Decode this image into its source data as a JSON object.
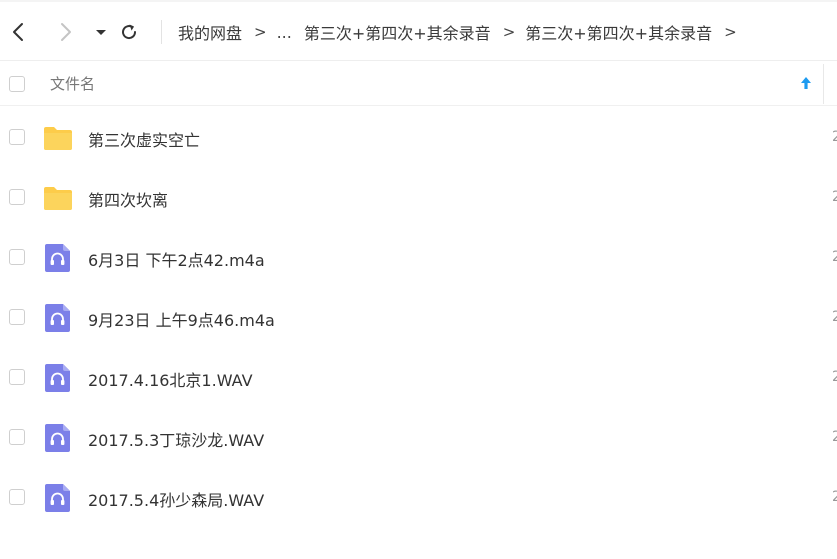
{
  "toolbar": {
    "back_icon": "chevron-left-icon",
    "forward_icon": "chevron-right-icon",
    "dropdown_icon": "caret-down-icon",
    "refresh_icon": "refresh-icon",
    "breadcrumb": {
      "items": [
        "我的网盘",
        "...",
        "第三次+第四次+其余录音",
        "第三次+第四次+其余录音"
      ],
      "separator": ">"
    }
  },
  "file_list": {
    "column_header": "文件名",
    "sort_icon": "arrow-up-icon",
    "sort_color": "#1e9bf0",
    "rows": [
      {
        "name": "第三次虚实空亡",
        "type": "folder",
        "edge": "2"
      },
      {
        "name": "第四次坎离",
        "type": "folder",
        "edge": "2"
      },
      {
        "name": "6月3日 下午2点42.m4a",
        "type": "audio",
        "edge": "2"
      },
      {
        "name": "9月23日 上午9点46.m4a",
        "type": "audio",
        "edge": "2"
      },
      {
        "name": "2017.4.16北京1.WAV",
        "type": "audio",
        "edge": "2"
      },
      {
        "name": "2017.5.3丁琼沙龙.WAV",
        "type": "audio",
        "edge": "2"
      },
      {
        "name": "2017.5.4孙少森局.WAV",
        "type": "audio",
        "edge": "2"
      }
    ]
  },
  "colors": {
    "folder": "#fdcc4a",
    "audio": "#7b7fe8"
  }
}
